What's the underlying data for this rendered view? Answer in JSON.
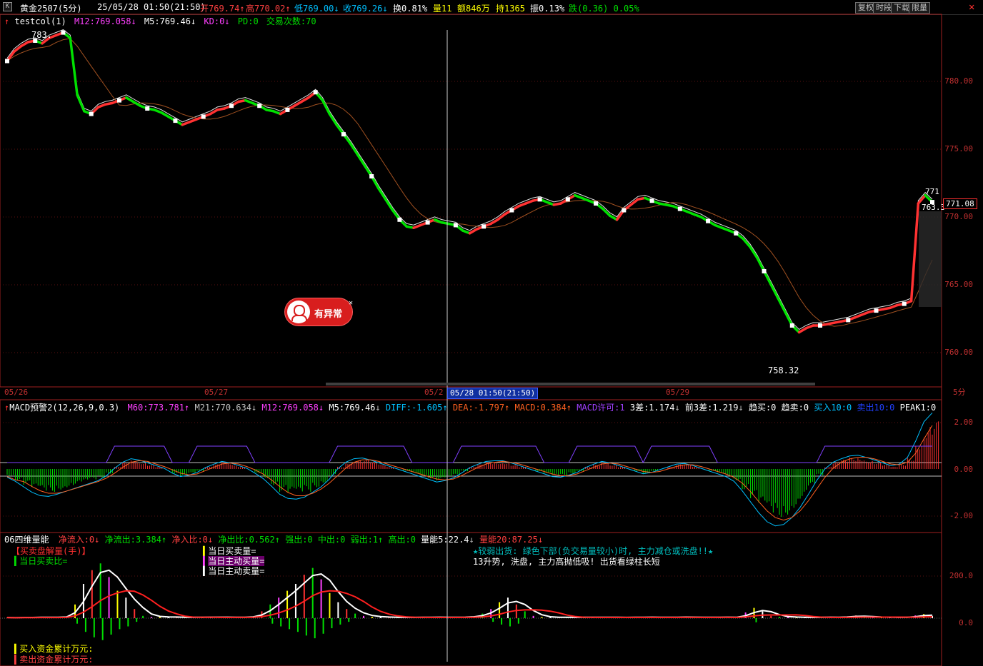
{
  "header": {
    "icon_letter": "K",
    "symbol": "黄金2507(5分)",
    "datetime": "25/05/28 01:50(21:50)",
    "open_label": "开",
    "open": "769.74",
    "high_label": "高",
    "high": "770.02",
    "low_label": "低",
    "low": "769.00",
    "close_label": "收",
    "close": "769.26",
    "turnover_label": "换",
    "turnover": "0.81%",
    "volume_label": "量",
    "volume": "11",
    "amount_label": "额",
    "amount": "846万",
    "hold_label": "持",
    "hold": "1365",
    "amplitude_label": "振",
    "amplitude": "0.13%",
    "change_label": "跌",
    "change": "(0.36)",
    "change_pct": "0.05%",
    "buttons": [
      "复权",
      "时段",
      "下载",
      "限量"
    ],
    "close_btn": "✕"
  },
  "price_panel": {
    "indicator_name": "testcol(1)",
    "m12": "M12:769.058",
    "m5": "M5:769.46",
    "kd": "KD:0",
    "pd": "PD:0",
    "trades": "交易次数:70",
    "high_label": "783.",
    "low_label": "758.32",
    "current_price": "771.08",
    "right_partial": "763.3",
    "right_top": "771",
    "y_ticks": [
      "780.00",
      "775.00",
      "770.00",
      "765.00",
      "760.00"
    ],
    "alert_text": "有异常",
    "alert_close": "✕"
  },
  "date_axis": {
    "labels": [
      "05/26",
      "05/27",
      "05/2",
      "05/29"
    ],
    "cursor_label": "05/28  01:50(21:50)",
    "period": "5分"
  },
  "macd_panel": {
    "title": "MACD预警2(12,26,9,0.3)",
    "m60": "M60:773.781",
    "m21": "M21:770.634",
    "m12": "M12:769.058",
    "m5": "M5:769.46",
    "diff": "DIFF:-1.605",
    "dea": "DEA:-1.797",
    "macd": "MACD:0.384",
    "macd_ok": "MACD许可:1",
    "diff3": "3差:1.174",
    "prev3": "前3差:1.219",
    "trend_buy": "趋买:0",
    "trend_sell": "趋卖:0",
    "buy10": "买入10:0",
    "sell10": "卖出10:0",
    "peak": "PEAK1:0",
    "y_ticks": [
      "2.00",
      "0.00",
      "-2.00"
    ]
  },
  "volume_panel": {
    "title": "06四维量能",
    "net_in": "净流入:0",
    "net_out": "净流出:3.384",
    "net_in_ratio": "净入比:0",
    "net_out_ratio": "净出比:0.562",
    "strong_out": "强出:0",
    "mid_out": "中出:0",
    "weak_out": "弱出:1",
    "high_out": "高出:0",
    "vol5": "量能5:22.4",
    "vol20": "量能20:87.25",
    "left_label1": "【买卖盘解量(手)】",
    "left_label2": "当日买卖比=",
    "mid_label1": "当日买卖量=",
    "mid_label2": "当日主动买量=",
    "mid_label3": "当日主动卖量=",
    "note1": "★较弱出货: 绿色下部(负交易量较小)时, 主力减仓或洗盘!!★",
    "note2": "13升势, 洗盘, 主力高抛低吸! 出货看绿柱长短",
    "bottom_label1": "买入资金累计万元:",
    "bottom_label2": "卖出资金累计万元:",
    "y_ticks": [
      "200.0",
      "0.0"
    ]
  },
  "colors": {
    "up": "#ff3232",
    "down": "#00e000",
    "axis": "#c03030",
    "yellow": "#ffff00",
    "magenta": "#ff40ff",
    "cyan": "#00c0ff",
    "white": "#ffffff"
  },
  "series": {
    "price": [
      781.5,
      782.2,
      782.6,
      782.9,
      783.0,
      782.8,
      783.2,
      783.4,
      783.6,
      783.2,
      779.0,
      777.8,
      777.6,
      778.1,
      778.3,
      778.4,
      778.6,
      778.8,
      778.5,
      778.2,
      778.0,
      777.9,
      777.7,
      777.4,
      777.1,
      776.8,
      777.0,
      777.2,
      777.4,
      777.6,
      777.9,
      778.0,
      778.2,
      778.5,
      778.6,
      778.4,
      778.2,
      777.9,
      777.8,
      777.6,
      777.9,
      778.2,
      778.5,
      778.8,
      779.2,
      778.6,
      777.6,
      776.8,
      776.1,
      775.4,
      774.6,
      773.8,
      773.0,
      772.1,
      771.3,
      770.5,
      769.8,
      769.3,
      769.2,
      769.4,
      769.6,
      769.8,
      769.6,
      769.5,
      769.4,
      769.0,
      768.8,
      769.1,
      769.3,
      769.5,
      769.8,
      770.2,
      770.5,
      770.8,
      771.0,
      771.2,
      771.3,
      771.1,
      770.9,
      771.0,
      771.3,
      771.6,
      771.4,
      771.2,
      771.0,
      770.6,
      770.1,
      769.8,
      770.5,
      770.9,
      771.3,
      771.4,
      771.2,
      771.0,
      770.9,
      770.8,
      770.6,
      770.4,
      770.2,
      770.0,
      769.7,
      769.4,
      769.2,
      769.0,
      768.8,
      768.4,
      767.8,
      767.0,
      766.0,
      765.0,
      764.0,
      763.0,
      762.0,
      761.5,
      761.8,
      762.0,
      762.0,
      762.1,
      762.2,
      762.3,
      762.4,
      762.6,
      762.8,
      763.0,
      763.1,
      763.2,
      763.3,
      763.5,
      763.6,
      763.8,
      771.0,
      771.6,
      771.1
    ],
    "macd": [
      -0.3,
      -0.5,
      -0.7,
      -0.9,
      -1.0,
      -1.0,
      -0.9,
      -0.8,
      -0.7,
      -0.6,
      -0.5,
      -0.4,
      -0.2,
      0.1,
      0.3,
      0.4,
      0.3,
      0.2,
      0.1,
      0.0,
      -0.2,
      -0.3,
      -0.2,
      -0.1,
      0.1,
      0.2,
      0.3,
      0.2,
      0.1,
      0.0,
      -0.2,
      -0.4,
      -0.7,
      -1.0,
      -1.1,
      -1.1,
      -1.0,
      -0.8,
      -0.6,
      -0.3,
      0.1,
      0.3,
      0.4,
      0.4,
      0.3,
      0.2,
      0.1,
      0.0,
      -0.1,
      -0.2,
      -0.3,
      -0.4,
      -0.5,
      -0.4,
      -0.3,
      -0.1,
      0.1,
      0.2,
      0.3,
      0.3,
      0.3,
      0.2,
      0.1,
      0.0,
      -0.1,
      -0.2,
      -0.3,
      -0.3,
      -0.2,
      -0.1,
      0.1,
      0.2,
      0.3,
      0.2,
      0.1,
      0.0,
      -0.1,
      -0.2,
      -0.1,
      0.0,
      0.1,
      0.2,
      0.2,
      0.1,
      0.0,
      -0.1,
      -0.2,
      -0.3,
      -0.5,
      -0.9,
      -1.3,
      -1.7,
      -2.0,
      -2.1,
      -2.0,
      -1.7,
      -1.3,
      -0.8,
      -0.3,
      0.1,
      0.3,
      0.4,
      0.5,
      0.5,
      0.4,
      0.3,
      0.2,
      0.1,
      0.2,
      0.5,
      1.2,
      1.9,
      2.1
    ],
    "vol": [
      3,
      2,
      4,
      3,
      5,
      3,
      4,
      8,
      60,
      150,
      210,
      240,
      180,
      120,
      90,
      40,
      10,
      5,
      8,
      4,
      3,
      5,
      4,
      3,
      6,
      4,
      3,
      5,
      4,
      8,
      30,
      60,
      90,
      120,
      150,
      190,
      220,
      170,
      110,
      70,
      40,
      20,
      10,
      6,
      5,
      4,
      3,
      4,
      3,
      4,
      5,
      4,
      3,
      4,
      6,
      8,
      20,
      40,
      70,
      90,
      60,
      30,
      10,
      5,
      4,
      3,
      5,
      4,
      3,
      5,
      4,
      3,
      4,
      3,
      4,
      5,
      4,
      3,
      5,
      4,
      5,
      4,
      3,
      4,
      5,
      4,
      3,
      25,
      45,
      30,
      10,
      6,
      5,
      4,
      3,
      4,
      5,
      4,
      3,
      8,
      12,
      6,
      4,
      5,
      4,
      3,
      4,
      12,
      18,
      10
    ]
  }
}
